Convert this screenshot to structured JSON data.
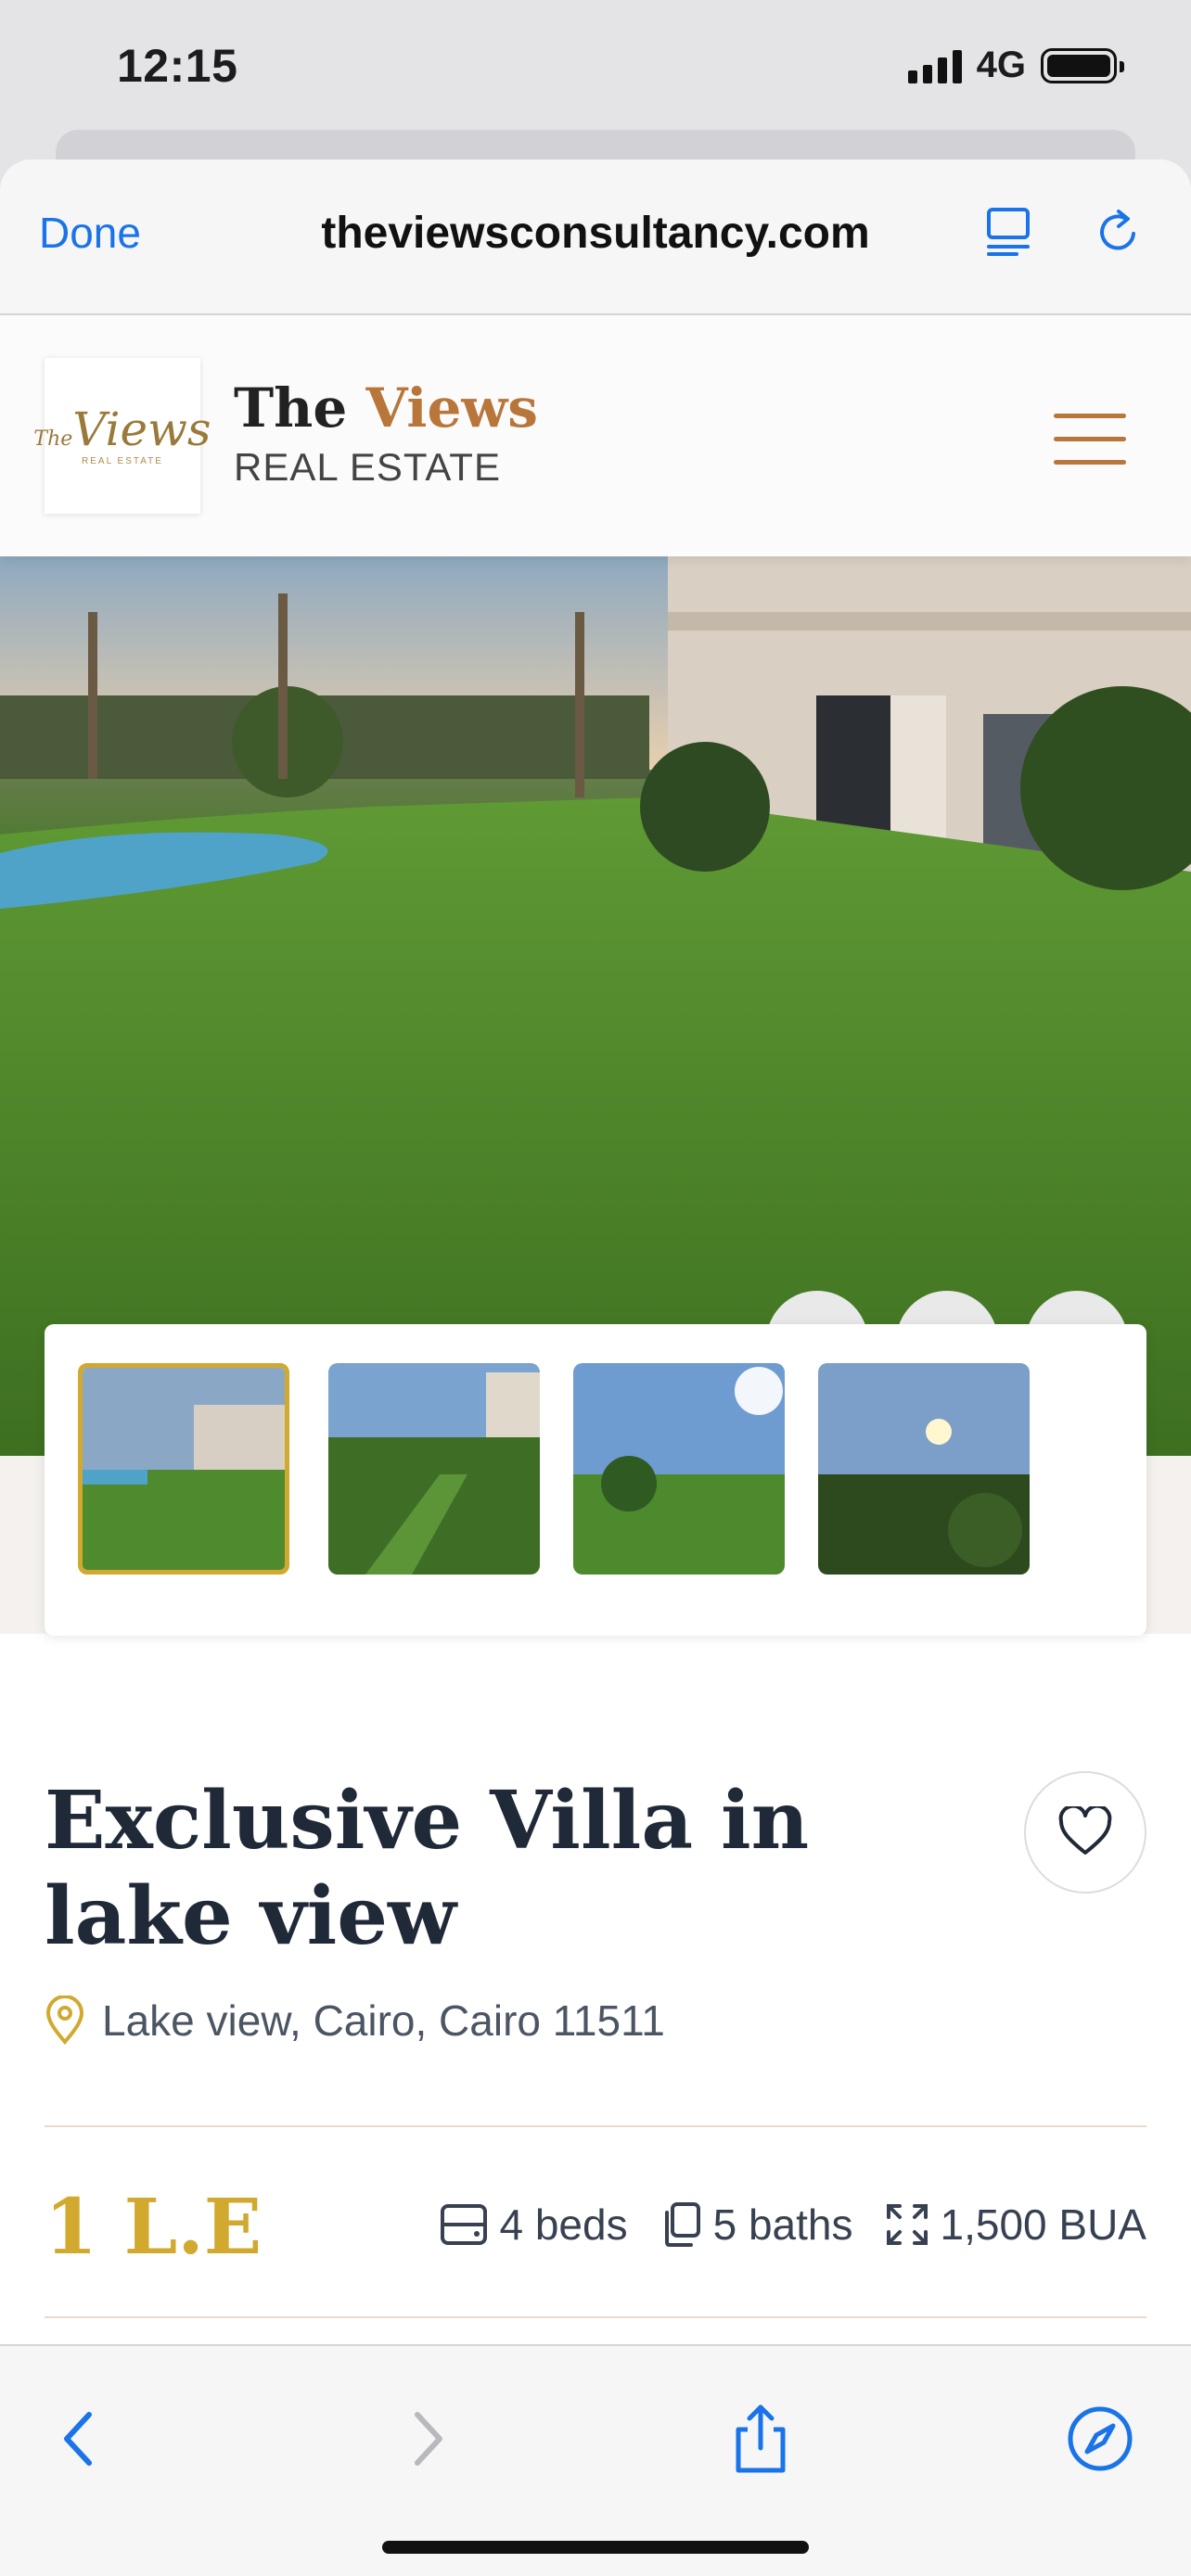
{
  "status_bar": {
    "time": "12:15",
    "network": "4G"
  },
  "browser": {
    "done_label": "Done",
    "url": "theviewsconsultancy.com",
    "reader_icon": "reader-mode-icon",
    "reload_icon": "reload-icon"
  },
  "site": {
    "logo_script": "Views",
    "logo_prefix": "The",
    "logo_small": "REAL ESTATE",
    "brand_the": "The",
    "brand_views": "Views",
    "brand_sub": "REAL ESTATE",
    "accent_color": "#b8763a"
  },
  "gallery": {
    "thumbnails": [
      "thumbnail-1",
      "thumbnail-2",
      "thumbnail-3",
      "thumbnail-4"
    ],
    "active_index": 0,
    "active_color": "#d0a92e"
  },
  "listing": {
    "title": "Exclusive Villa in lake view",
    "location": "Lake view, Cairo, Cairo 11511",
    "price": "1 L.E",
    "beds": "4 beds",
    "baths": "5 baths",
    "area": "1,500 BUA",
    "price_color": "#d0a92e"
  },
  "toolbar": {
    "back_icon": "back-arrow-icon",
    "forward_icon": "forward-arrow-icon",
    "share_icon": "share-icon",
    "safari_icon": "compass-icon"
  }
}
